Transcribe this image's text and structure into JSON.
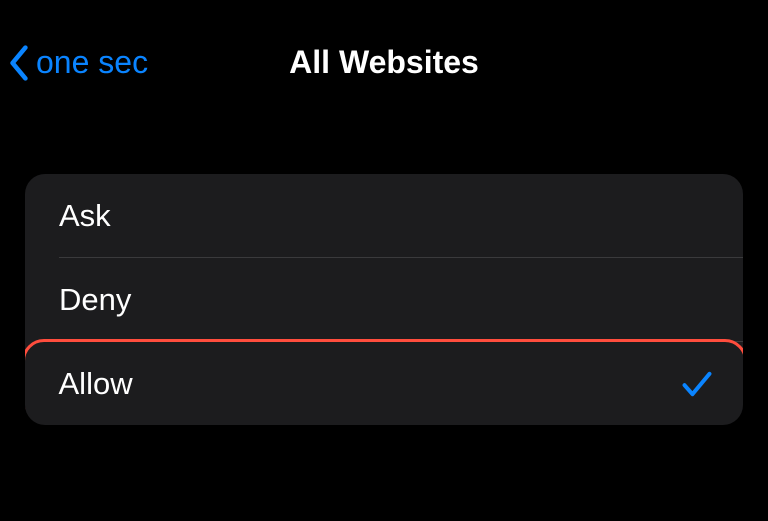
{
  "header": {
    "back_label": "one sec",
    "title": "All Websites"
  },
  "options": [
    {
      "label": "Ask",
      "selected": false,
      "highlighted": false
    },
    {
      "label": "Deny",
      "selected": false,
      "highlighted": false
    },
    {
      "label": "Allow",
      "selected": true,
      "highlighted": true
    }
  ],
  "colors": {
    "accent": "#0a84ff",
    "highlight": "#ff4d3d"
  }
}
